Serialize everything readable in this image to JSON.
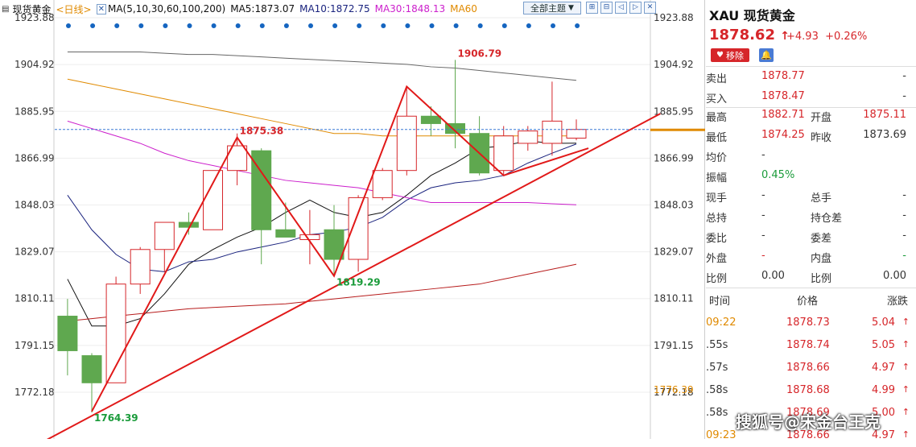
{
  "toolbar": {
    "instrument": "现货黄金",
    "period": "<日线>",
    "ma_params": "MA(5,10,30,60,100,200)",
    "ma5": "MA5:1873.07",
    "ma10": "MA10:1872.75",
    "ma30": "MA30:1848.13",
    "ma60": "MA60",
    "themes": "全部主题",
    "tool_icons": [
      "⊞",
      "⊟",
      "◁",
      "▷",
      "✕"
    ]
  },
  "colors": {
    "up": "#d6262a",
    "down": "#5fa84f",
    "ma5": "#111111",
    "ma10": "#1a237e",
    "ma30": "#cc1fcc",
    "ma60": "#e08a00",
    "ma200": "#b71c1c",
    "ma100": "#666666",
    "trend": "#e11919",
    "dot": "#1565c0",
    "price_line": "#3a78d6"
  },
  "chart_data": {
    "type": "candlestick",
    "ylim": [
      1762,
      1928
    ],
    "y_ticks": [
      1923.88,
      1904.92,
      1885.95,
      1866.99,
      1848.03,
      1829.07,
      1810.11,
      1791.15,
      1772.18
    ],
    "y_tick_labels": [
      "1923.88",
      "1904.92",
      "1885.95",
      "1866.99",
      "1848.03",
      "1829.07",
      "1810.11",
      "1791.15",
      "1772.18"
    ],
    "current_price": 1878.62,
    "current_price_label": "1878.62",
    "right_marker_label": "1776.39",
    "candles": [
      {
        "o": 1803,
        "h": 1810,
        "l": 1779,
        "c": 1789
      },
      {
        "o": 1787,
        "h": 1788,
        "l": 1764,
        "c": 1776
      },
      {
        "o": 1776,
        "h": 1819,
        "l": 1776,
        "c": 1816
      },
      {
        "o": 1816,
        "h": 1831,
        "l": 1812,
        "c": 1830
      },
      {
        "o": 1830,
        "h": 1840,
        "l": 1821,
        "c": 1841
      },
      {
        "o": 1841,
        "h": 1845,
        "l": 1836,
        "c": 1839
      },
      {
        "o": 1838,
        "h": 1862,
        "l": 1838,
        "c": 1862
      },
      {
        "o": 1862,
        "h": 1877,
        "l": 1856,
        "c": 1872
      },
      {
        "o": 1870,
        "h": 1871,
        "l": 1824,
        "c": 1838
      },
      {
        "o": 1838,
        "h": 1849,
        "l": 1835,
        "c": 1835
      },
      {
        "o": 1834,
        "h": 1846,
        "l": 1824,
        "c": 1836
      },
      {
        "o": 1838,
        "h": 1848,
        "l": 1819,
        "c": 1826
      },
      {
        "o": 1826,
        "h": 1852,
        "l": 1821,
        "c": 1851
      },
      {
        "o": 1851,
        "h": 1863,
        "l": 1850,
        "c": 1862
      },
      {
        "o": 1862,
        "h": 1896,
        "l": 1860,
        "c": 1884
      },
      {
        "o": 1884,
        "h": 1888,
        "l": 1876,
        "c": 1881
      },
      {
        "o": 1881,
        "h": 1906.79,
        "l": 1871,
        "c": 1877
      },
      {
        "o": 1877,
        "h": 1884,
        "l": 1860,
        "c": 1861
      },
      {
        "o": 1862,
        "h": 1880,
        "l": 1860,
        "c": 1876
      },
      {
        "o": 1873,
        "h": 1880,
        "l": 1870,
        "c": 1878
      },
      {
        "o": 1873,
        "h": 1898,
        "l": 1868,
        "c": 1882
      },
      {
        "o": 1875.11,
        "h": 1882.71,
        "l": 1874.25,
        "c": 1878.62
      }
    ],
    "ma_lines": [
      {
        "name": "MA5",
        "color_key": "ma5",
        "values": [
          1818,
          1799,
          1799,
          1802,
          1812,
          1824,
          1830,
          1835,
          1839,
          1845,
          1850,
          1845,
          1843,
          1845,
          1852,
          1860,
          1865,
          1871,
          1872,
          1874,
          1873,
          1873.07
        ]
      },
      {
        "name": "MA10",
        "color_key": "ma10",
        "values": [
          1852,
          1838,
          1828,
          1822,
          1821,
          1825,
          1826,
          1829,
          1831,
          1833,
          1836,
          1837,
          1839,
          1843,
          1850,
          1855,
          1857,
          1858,
          1860,
          1865,
          1869,
          1872.75
        ]
      },
      {
        "name": "MA30",
        "color_key": "ma30",
        "values": [
          1882,
          1879,
          1876,
          1873,
          1869,
          1866,
          1864,
          1862,
          1860,
          1858,
          1857,
          1856,
          1855,
          1853,
          1851,
          1849,
          1849,
          1849,
          1849,
          1849,
          1848.5,
          1848.13
        ]
      },
      {
        "name": "MA60",
        "color_key": "ma60",
        "values": [
          1899,
          1897,
          1895,
          1893,
          1891,
          1889,
          1887,
          1885,
          1883,
          1881,
          1879,
          1877,
          1877,
          1876,
          1876,
          1876,
          1876,
          1876,
          1876,
          1876,
          1876,
          1876
        ]
      },
      {
        "name": "MA100",
        "color_key": "ma100",
        "values": [
          1910,
          1910,
          1910,
          1910,
          1909.5,
          1909,
          1909,
          1908.5,
          1908,
          1907.5,
          1907,
          1906.5,
          1906,
          1905.5,
          1905,
          1904,
          1903.5,
          1902.5,
          1901.5,
          1900.5,
          1899.5,
          1898.5
        ]
      },
      {
        "name": "MA200",
        "color_key": "ma200",
        "values": [
          1801,
          1802,
          1803,
          1804,
          1805,
          1806,
          1806.5,
          1807,
          1807.5,
          1808,
          1809,
          1810,
          1811,
          1812,
          1813,
          1814,
          1815,
          1816,
          1818,
          1820,
          1822,
          1824
        ]
      }
    ],
    "annotations": [
      {
        "text": "1906.79",
        "i": 16,
        "value": 1906.79,
        "kind": "high"
      },
      {
        "text": "1875.38",
        "i": 7,
        "value": 1875.38,
        "kind": "high"
      },
      {
        "text": "1819.29",
        "i": 11,
        "value": 1819.29,
        "kind": "low"
      },
      {
        "text": "1764.39",
        "i": 1,
        "value": 1764.39,
        "kind": "low"
      }
    ],
    "pattern_points": [
      {
        "i": 1,
        "v": 1764.39
      },
      {
        "i": 7,
        "v": 1875.38
      },
      {
        "i": 11,
        "v": 1819.29
      },
      {
        "i": 14,
        "v": 1896
      },
      {
        "i": 18,
        "v": 1860
      },
      {
        "i": 21.5,
        "v": 1871
      }
    ],
    "trend_line": [
      {
        "i": -1,
        "v": 1752
      },
      {
        "i": 24.5,
        "v": 1885
      }
    ]
  },
  "panel": {
    "title": "XAU 现货黄金",
    "price": "1878.62",
    "price_arrow": "↑",
    "change": "+4.93",
    "change_pct": "+0.26%",
    "remove_btn": "移除",
    "bell_icon": "bell-icon",
    "quote_rows": [
      {
        "l1": "卖出",
        "v1": "1878.77",
        "c1": "red",
        "l2": "",
        "v2": "-",
        "c2": ""
      },
      {
        "l1": "买入",
        "v1": "1878.47",
        "c1": "red",
        "l2": "",
        "v2": "-",
        "c2": ""
      }
    ],
    "stat_rows": [
      {
        "l1": "最高",
        "v1": "1882.71",
        "c1": "red",
        "l2": "开盘",
        "v2": "1875.11",
        "c2": "red"
      },
      {
        "l1": "最低",
        "v1": "1874.25",
        "c1": "red",
        "l2": "昨收",
        "v2": "1873.69",
        "c2": ""
      },
      {
        "l1": "均价",
        "v1": "-",
        "c1": "",
        "l2": "",
        "v2": "",
        "c2": ""
      },
      {
        "l1": "振幅",
        "v1": "0.45%",
        "c1": "green",
        "l2": "",
        "v2": "",
        "c2": ""
      },
      {
        "l1": "现手",
        "v1": "-",
        "c1": "",
        "l2": "总手",
        "v2": "-",
        "c2": ""
      },
      {
        "l1": "总持",
        "v1": "-",
        "c1": "",
        "l2": "持仓差",
        "v2": "-",
        "c2": ""
      },
      {
        "l1": "委比",
        "v1": "-",
        "c1": "",
        "l2": "委差",
        "v2": "-",
        "c2": ""
      },
      {
        "l1": "外盘",
        "v1": "-",
        "c1": "red",
        "l2": "内盘",
        "v2": "-",
        "c2": "green"
      },
      {
        "l1": "比例",
        "v1": "0.00",
        "c1": "",
        "l2": "比例",
        "v2": "0.00",
        "c2": ""
      }
    ],
    "ticks_header": {
      "time": "时间",
      "price": "价格",
      "change": "涨跌"
    },
    "ticks": [
      {
        "time": "09:22",
        "price": "1878.73",
        "change": "5.04",
        "time_color": "#e08a00"
      },
      {
        "time": ".55s",
        "price": "1878.74",
        "change": "5.05",
        "time_color": "#333"
      },
      {
        "time": ".57s",
        "price": "1878.66",
        "change": "4.97",
        "time_color": "#333"
      },
      {
        "time": ".58s",
        "price": "1878.68",
        "change": "4.99",
        "time_color": "#333"
      },
      {
        "time": ".58s",
        "price": "1878.69",
        "change": "5.00",
        "time_color": "#333"
      },
      {
        "time": "09:23",
        "price": "1878.66",
        "change": "4.97",
        "time_color": "#e08a00"
      }
    ]
  },
  "watermark": "搜狐号@宋金台王克"
}
